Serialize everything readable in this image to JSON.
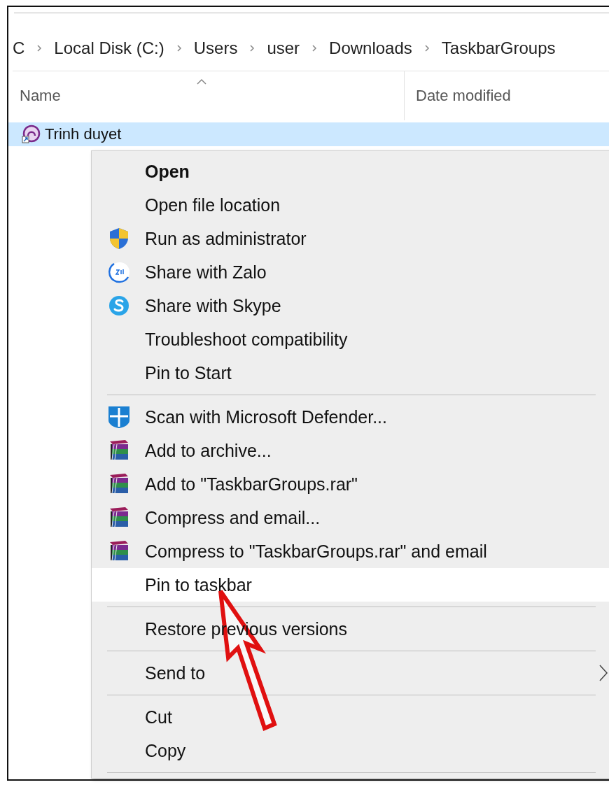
{
  "breadcrumb": [
    "C",
    "Local Disk (C:)",
    "Users",
    "user",
    "Downloads",
    "TaskbarGroups"
  ],
  "columns": [
    {
      "label": "Name",
      "sorted": true
    },
    {
      "label": "Date modified"
    }
  ],
  "files": [
    {
      "name": "Trinh duyet",
      "selected": true
    }
  ],
  "context_menu": {
    "sections": [
      [
        {
          "label": "Open",
          "kind": "plain",
          "bold": true,
          "selected": false
        },
        {
          "label": "Open file location",
          "kind": "plain",
          "selected": false
        },
        {
          "label": "Run as administrator",
          "kind": "shield",
          "selected": false
        },
        {
          "label": "Share with Zalo",
          "kind": "zalo",
          "selected": false
        },
        {
          "label": "Share with Skype",
          "kind": "skype",
          "selected": false
        },
        {
          "label": "Troubleshoot compatibility",
          "kind": "plain",
          "selected": false
        },
        {
          "label": "Pin to Start",
          "kind": "plain",
          "selected": false
        }
      ],
      [
        {
          "label": "Scan with Microsoft Defender...",
          "kind": "defender",
          "selected": false
        },
        {
          "label": "Add to archive...",
          "kind": "archive",
          "selected": false
        },
        {
          "label": "Add to \"TaskbarGroups.rar\"",
          "kind": "archive",
          "selected": false
        },
        {
          "label": "Compress and email...",
          "kind": "archive",
          "selected": false
        },
        {
          "label": "Compress to \"TaskbarGroups.rar\" and email",
          "kind": "archive",
          "selected": false
        },
        {
          "label": "Pin to taskbar",
          "kind": "plain",
          "selected": true
        }
      ],
      [
        {
          "label": "Restore previous versions",
          "kind": "plain",
          "selected": false
        }
      ],
      [
        {
          "label": "Send to",
          "kind": "plain",
          "submenu": true,
          "selected": false
        }
      ],
      [
        {
          "label": "Cut",
          "kind": "plain",
          "selected": false
        },
        {
          "label": "Copy",
          "kind": "plain",
          "selected": false
        }
      ]
    ]
  }
}
